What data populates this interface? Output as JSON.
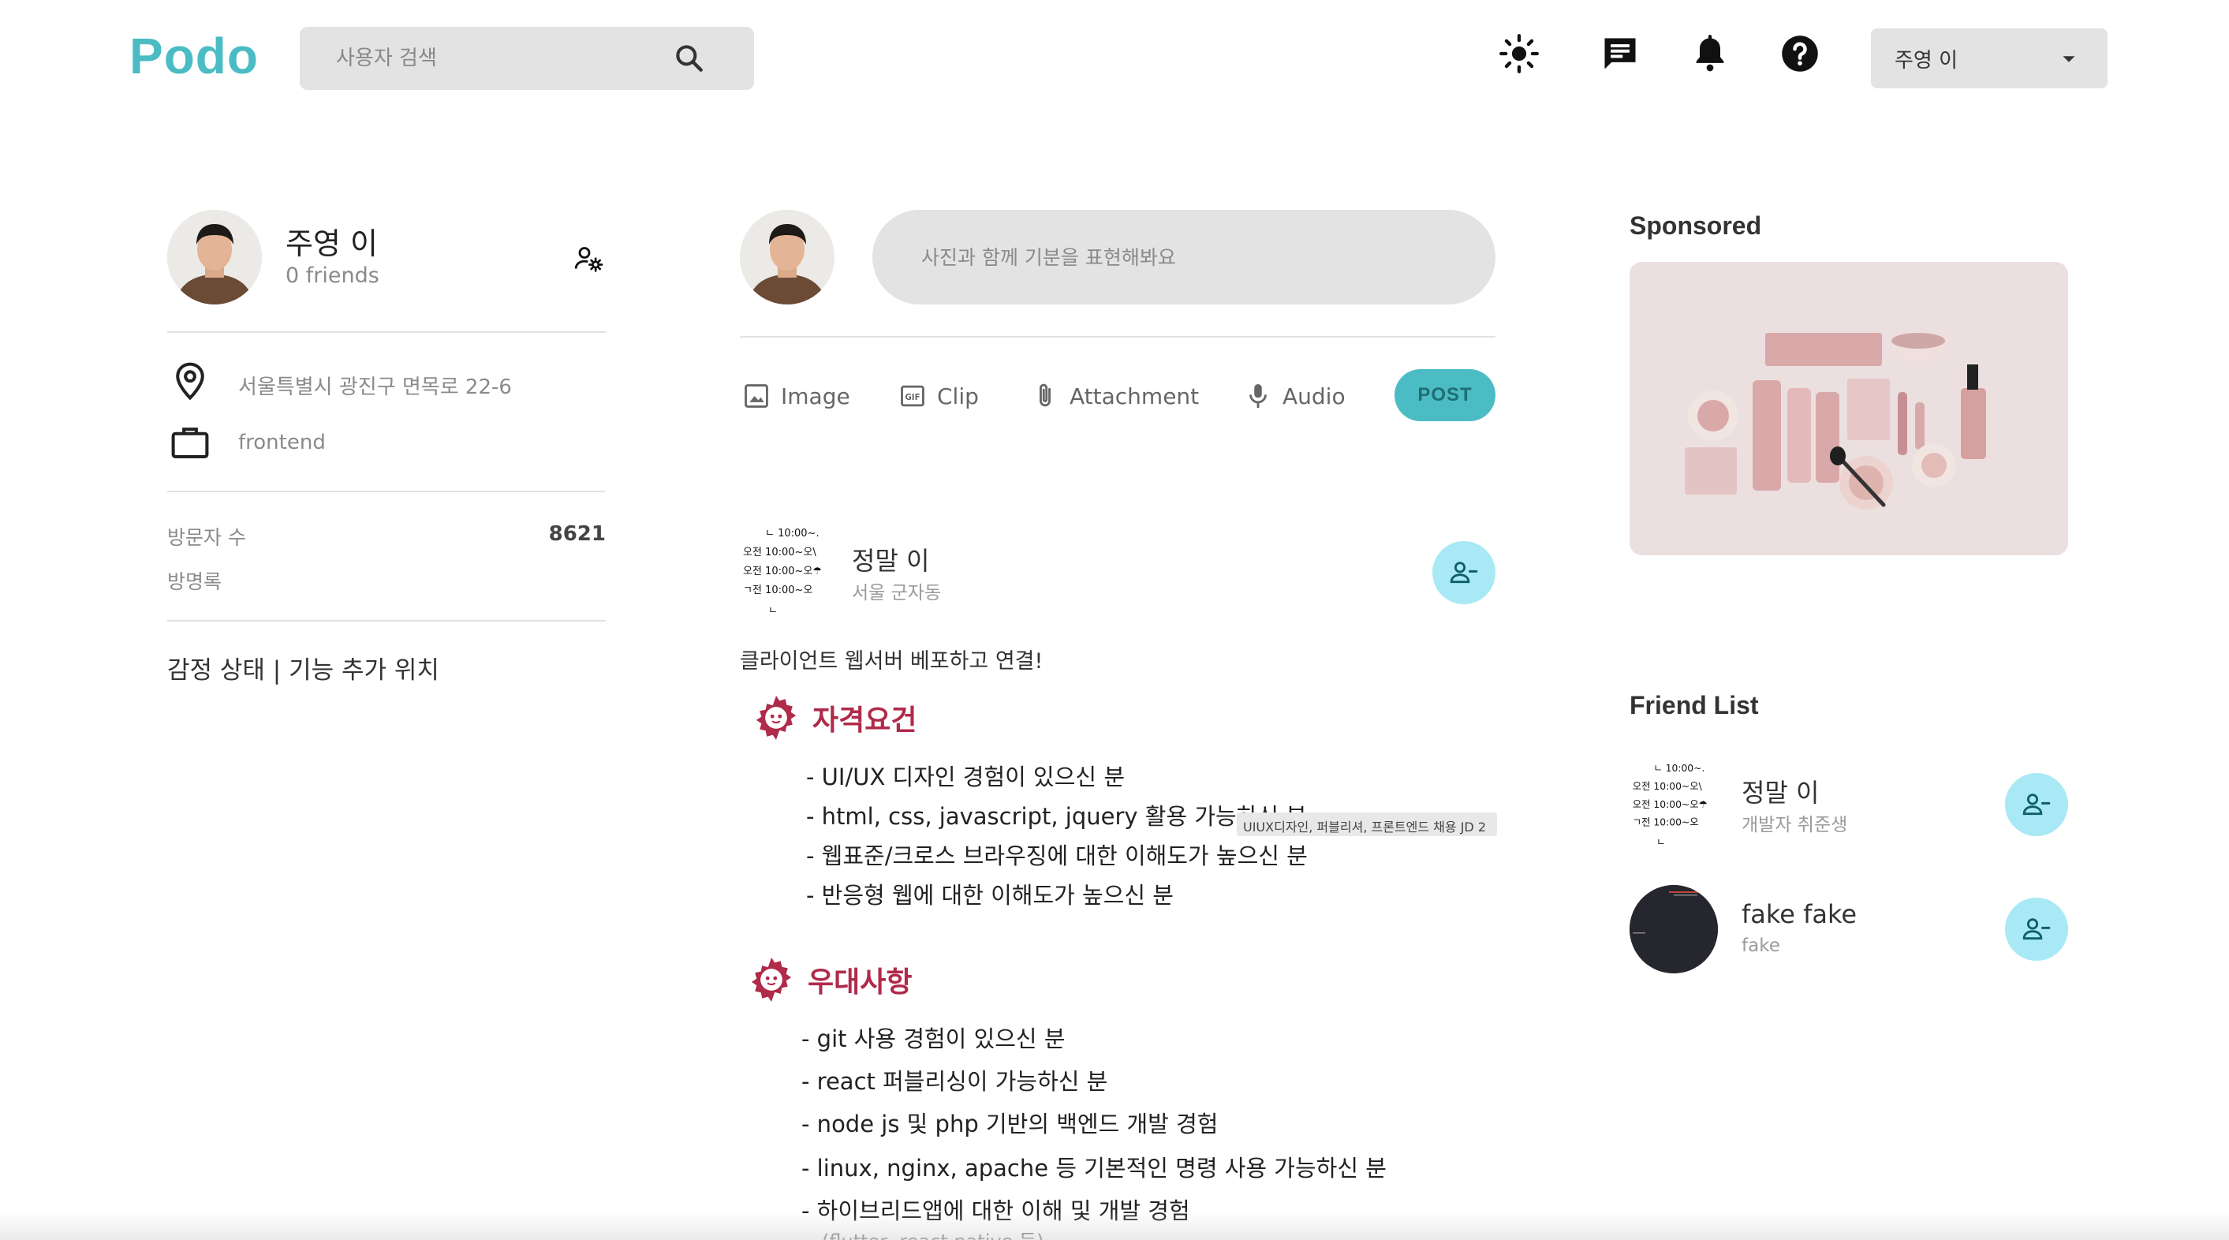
{
  "header": {
    "logo": "Podo",
    "search_placeholder": "사용자 검색",
    "current_user": "주영 이"
  },
  "profile": {
    "name": "주영 이",
    "friends": "0 friends",
    "location": "서울특별시 광진구 면목로 22-6",
    "job": "frontend",
    "visitors_label": "방문자 수",
    "visitors_count": "8621",
    "guestbook_label": "방명록",
    "mood": "감정 상태 | 기능 추가 위치"
  },
  "compose": {
    "placeholder": "사진과 함께 기분을 표현해봐요",
    "actions": {
      "image": "Image",
      "clip": "Clip",
      "attachment": "Attachment",
      "audio": "Audio"
    },
    "post_label": "POST"
  },
  "feed": {
    "post": {
      "author": "정말 이",
      "location": "서울 군자동",
      "text": "클라이언트 웹서버 베포하고 연결!",
      "image": {
        "section1_title": "자격요건",
        "section1_items": [
          "- UI/UX 디자인 경험이 있으신 분",
          "- html, css, javascript, jquery 활용 가능하신 분",
          "- 웹표준/크로스 브라우징에 대한 이해도가 높으신 분",
          "- 반응형 웹에 대한 이해도가 높으신 분"
        ],
        "section2_title": "우대사항",
        "section2_items": [
          "- git 사용 경험이 있으신 분",
          "- react 퍼블리싱이 가능하신 분",
          "- node js 및 php 기반의 백엔드 개발 경험",
          "- linux, nginx, apache 등 기본적인 명령 사용 가능하신 분",
          "- 하이브리드앱에 대한 이해 및 개발 경험",
          "(flutter, react native 등)"
        ],
        "tooltip": "UIUX디자인, 퍼블리셔, 프론트엔드 채용 JD 2"
      }
    }
  },
  "sidebar": {
    "sponsored_title": "Sponsored",
    "friend_list_title": "Friend List",
    "friends": [
      {
        "name": "정말 이",
        "subtitle": "개발자 취준생"
      },
      {
        "name": "fake fake",
        "subtitle": "fake"
      }
    ]
  },
  "thumbnail_text": [
    "ㄴ 10:00~.",
    "오전 10:00~오\\",
    "오전 10:00~오☂",
    "ㄱ전 10:00~오",
    "ㄴ"
  ],
  "colors": {
    "brand": "#4bbcc4",
    "remove_friend_bg": "#a8e9f5",
    "jd_accent": "#b02a4a"
  },
  "icons": [
    "search-icon",
    "sun-icon",
    "chat-icon",
    "bell-icon",
    "help-icon",
    "caret-down-icon",
    "manage-accounts-icon",
    "location-icon",
    "briefcase-icon",
    "image-icon",
    "gif-icon",
    "attachment-icon",
    "mic-icon",
    "person-remove-icon"
  ]
}
